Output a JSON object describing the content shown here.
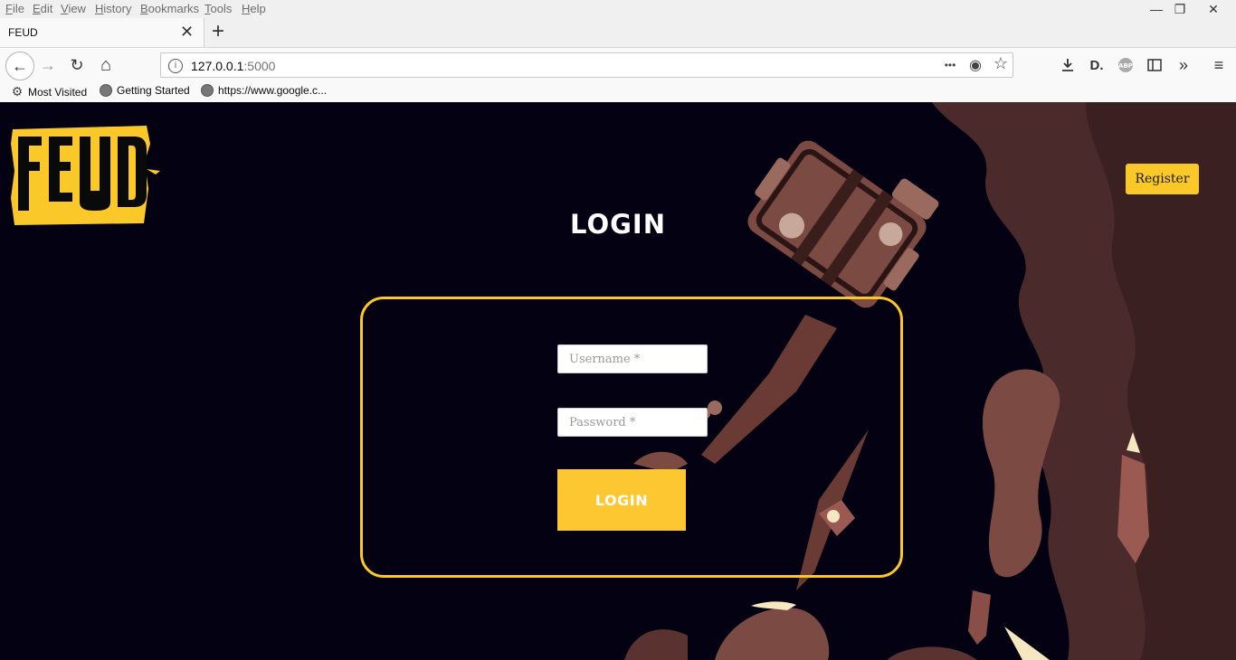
{
  "menu": [
    "File",
    "Edit",
    "View",
    "History",
    "Bookmarks",
    "Tools",
    "Help"
  ],
  "window_controls": {
    "minimize": "—",
    "restore": "❐",
    "close": "✕"
  },
  "tab": {
    "title": "FEUD",
    "close": "✕",
    "new_tab": "+"
  },
  "nav": {
    "back": "←",
    "forward": "→",
    "reload": "↻",
    "home": "⌂",
    "url_host": "127.0.0.1",
    "url_port": ":5000",
    "page_actions": "•••",
    "pocket": "◉",
    "bookmark": "☆"
  },
  "toolbar_icons": [
    "download-icon",
    "dashlane-icon",
    "adblock-icon",
    "sidebar-icon",
    "overflow-icon",
    "menu-icon"
  ],
  "bookmarks": [
    "Most Visited",
    "Getting Started",
    "https://www.google.c..."
  ],
  "page": {
    "logo_text": "FEUD",
    "register_label": "Register",
    "title": "LOGIN",
    "username_placeholder": "Username *",
    "password_placeholder": "Password *",
    "login_label": "LOGIN"
  },
  "colors": {
    "background": "#040212",
    "accent": "#fbc829",
    "art_brown": "#7a4a43"
  }
}
